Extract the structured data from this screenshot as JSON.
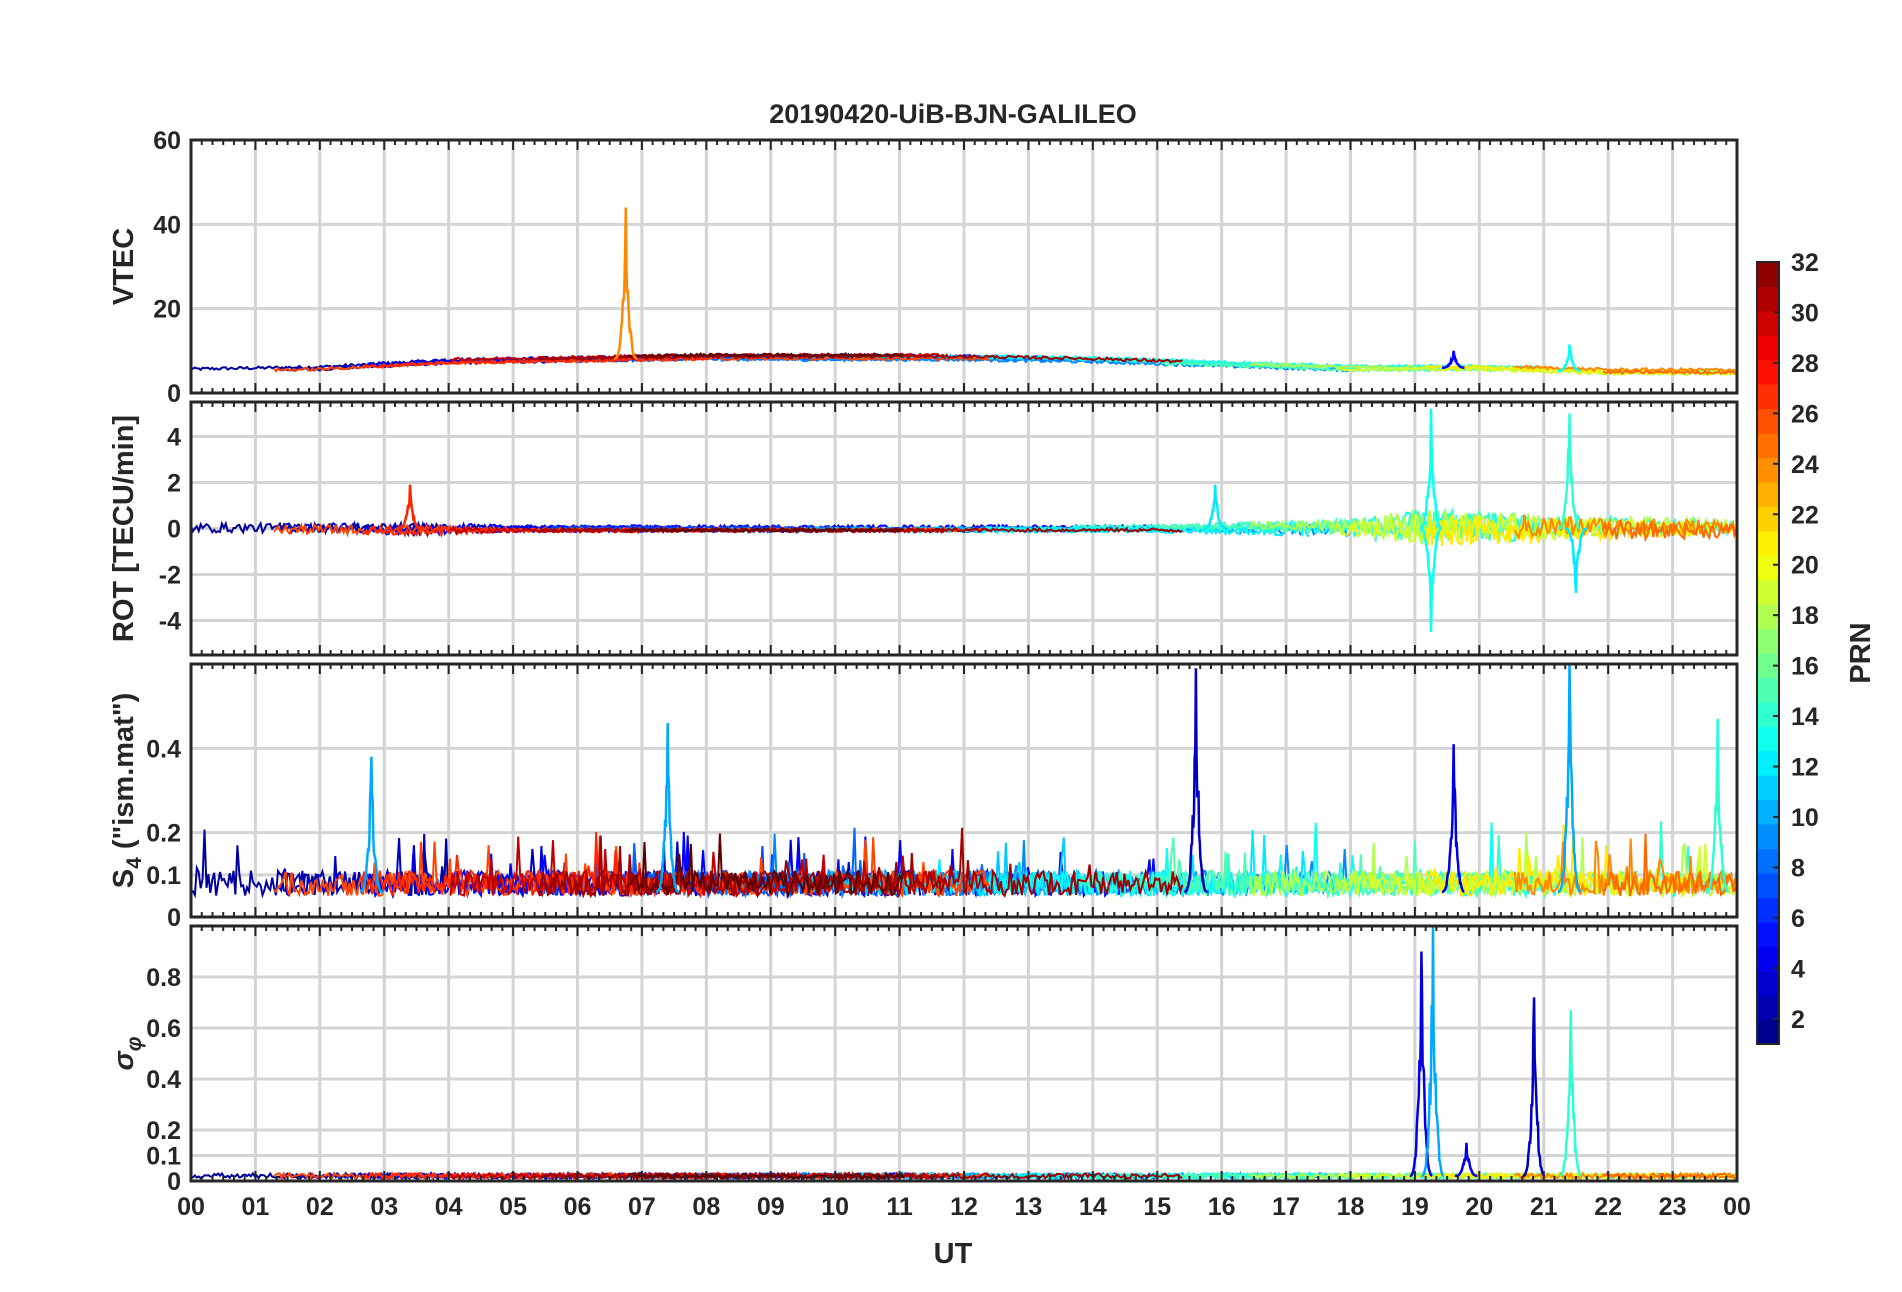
{
  "chart_data": {
    "type": "line",
    "title": "20190420-UiB-BJN-GALILEO",
    "xlabel": "UT",
    "x_tick_labels": [
      "00",
      "01",
      "02",
      "03",
      "04",
      "05",
      "06",
      "07",
      "08",
      "09",
      "10",
      "11",
      "12",
      "13",
      "14",
      "15",
      "16",
      "17",
      "18",
      "19",
      "20",
      "21",
      "22",
      "23",
      "00"
    ],
    "xlim_hours": [
      0,
      24
    ],
    "grid": true,
    "colorbar": {
      "label": "PRN",
      "range": [
        1,
        32
      ],
      "colormap": "jet",
      "tick_labels": [
        "2",
        "4",
        "6",
        "8",
        "10",
        "12",
        "14",
        "16",
        "18",
        "20",
        "22",
        "24",
        "26",
        "28",
        "30",
        "32"
      ],
      "colors": [
        "#00008f",
        "#0000ff",
        "#0080ff",
        "#00ffff",
        "#80ff80",
        "#ffff00",
        "#ff8000",
        "#ff0000",
        "#800000"
      ]
    },
    "panels": [
      {
        "ylabel": "VTEC",
        "ylim": [
          0,
          60
        ],
        "y_tick_labels": [
          "0",
          "20",
          "40",
          "60"
        ],
        "baseline": [
          [
            0,
            5.5
          ],
          [
            2,
            6
          ],
          [
            4,
            7.5
          ],
          [
            6,
            8
          ],
          [
            8,
            8.5
          ],
          [
            12,
            8.5
          ],
          [
            14,
            8
          ],
          [
            16,
            7
          ],
          [
            18,
            6
          ],
          [
            20,
            6
          ],
          [
            22,
            5
          ],
          [
            24,
            5
          ]
        ],
        "spread": 1.2,
        "features": [
          {
            "t": 6.75,
            "peak": 44,
            "prn": 24,
            "note": "spike"
          },
          {
            "t": 19.6,
            "peak": 10,
            "prn": 5
          },
          {
            "t": 21.4,
            "peak": 11.5,
            "prn": 13
          }
        ]
      },
      {
        "ylabel": "ROT [TECU/min]",
        "ylim": [
          -5.5,
          5.5
        ],
        "y_tick_labels": [
          "-4",
          "-2",
          "0",
          "2",
          "4"
        ],
        "baseline": [
          [
            0,
            0
          ],
          [
            24,
            0
          ]
        ],
        "noise": [
          [
            0,
            0.4
          ],
          [
            3.5,
            0.4
          ],
          [
            5,
            0.15
          ],
          [
            15,
            0.15
          ],
          [
            18,
            0.6
          ],
          [
            19,
            1.5
          ],
          [
            22,
            0.8
          ],
          [
            24,
            0.6
          ]
        ],
        "features": [
          {
            "t": 3.4,
            "peak": 1.9,
            "prn": 27
          },
          {
            "t": 15.9,
            "peak": 1.9,
            "prn": 12
          },
          {
            "t": 19.25,
            "peak": 5.2,
            "prn": 13
          },
          {
            "t": 19.25,
            "peak": -4.5,
            "prn": 13
          },
          {
            "t": 21.4,
            "peak": 5.0,
            "prn": 14
          },
          {
            "t": 21.5,
            "peak": -2.8,
            "prn": 12
          }
        ]
      },
      {
        "ylabel": "S4 (\"ism.mat\")",
        "ylabel_main": "S",
        "ylabel_sub": "4",
        "ylabel_rest": " (\"ism.mat\")",
        "ylim": [
          0,
          0.6
        ],
        "y_tick_labels": [
          "0",
          "0.1",
          "0.2",
          "0.4"
        ],
        "y_tick_values": [
          0,
          0.1,
          0.2,
          0.4
        ],
        "baseline": [
          [
            0,
            0.06
          ],
          [
            24,
            0.06
          ]
        ],
        "features": [
          {
            "t": 2.8,
            "peak": 0.38,
            "prn": 10
          },
          {
            "t": 7.4,
            "peak": 0.46,
            "prn": 10
          },
          {
            "t": 15.6,
            "peak": 0.59,
            "prn": 3
          },
          {
            "t": 19.6,
            "peak": 0.41,
            "prn": 4
          },
          {
            "t": 21.4,
            "peak": 0.6,
            "prn": 10
          },
          {
            "t": 23.7,
            "peak": 0.47,
            "prn": 14
          }
        ]
      },
      {
        "ylabel": "σ φ",
        "ylabel_main": "σ",
        "ylabel_sub": "φ",
        "ylim": [
          0,
          1
        ],
        "y_tick_labels": [
          "0",
          "0.1",
          "0.2",
          "0.4",
          "0.6",
          "0.8"
        ],
        "y_tick_values": [
          0,
          0.1,
          0.2,
          0.4,
          0.6,
          0.8
        ],
        "baseline": [
          [
            0,
            0.02
          ],
          [
            24,
            0.02
          ]
        ],
        "features": [
          {
            "t": 19.1,
            "peak": 0.9,
            "prn": 4
          },
          {
            "t": 19.28,
            "peak": 1.0,
            "prn": 10
          },
          {
            "t": 20.85,
            "peak": 0.72,
            "prn": 3
          },
          {
            "t": 21.42,
            "peak": 0.67,
            "prn": 14
          },
          {
            "t": 19.8,
            "peak": 0.15,
            "prn": 4
          }
        ]
      }
    ]
  }
}
